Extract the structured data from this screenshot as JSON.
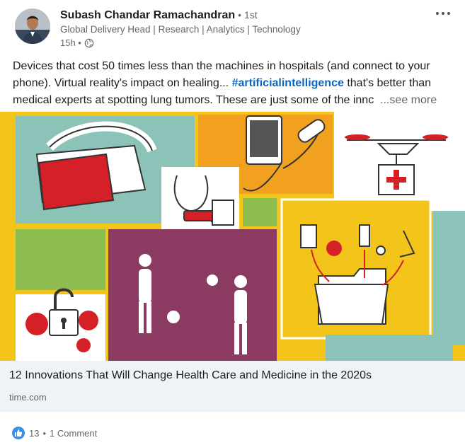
{
  "author": {
    "name": "Subash Chandar Ramachandran",
    "degree": "• 1st",
    "headline": "Global Delivery Head | Research | Analytics | Technology",
    "timestamp": "15h •",
    "visibility_icon": "globe-icon"
  },
  "post": {
    "line1": "Devices that cost 50 times less than the machines in hospitals (and connect to your",
    "line2_before": "phone). Virtual reality's impact on healing... ",
    "hashtag": "#artificialintelligence",
    "line2_after": " that's better than",
    "line3": "medical experts at spotting lung tumors. These are just some of the innc",
    "see_more": "...see more"
  },
  "article": {
    "title": "12 Innovations That Will Change Health Care and Medicine in the 2020s",
    "source": "time.com"
  },
  "social": {
    "reaction_icon": "thumbs-up-icon",
    "reactions_count": "13",
    "separator": "•",
    "comments": "1 Comment"
  },
  "colors": {
    "accent": "#0a66c2",
    "image_yellow": "#f3c41a",
    "image_teal": "#8cc3b9",
    "image_orange": "#f2a11e",
    "image_purple": "#8b3a62",
    "image_green": "#8dbd4e",
    "image_red": "#d62027"
  }
}
